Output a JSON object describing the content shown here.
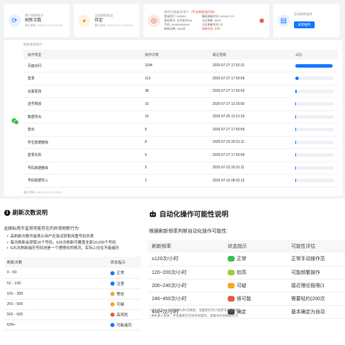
{
  "cards": {
    "c1": {
      "title": "用户刷新统计",
      "value": "刷新次数",
      "sub": "最近更新: 2025-07-27 17:52:31",
      "icon": "refresh-icon",
      "color": "#1677ff"
    },
    "c2": {
      "title": "当前刷新状态",
      "value": "待定",
      "sub": "最近更新: 2025-07-27 17:52:31",
      "icon": "user-icon",
      "color": "#f5a623"
    },
    "c3": {
      "title": "刷新次数最多用户",
      "title_tag": "（平台刷新排行榜）",
      "rows": [
        [
          "登录用户: 000001",
          "最高刷新时间: 2025-07-21"
        ],
        [
          "绑定账号: 学生账号001",
          "当日刷新: 3603"
        ],
        [
          "手机: 100000000001",
          "当日刷新时间: 次"
        ],
        [
          "刷新次数: 1184次",
          "刷新状态: 异常"
        ]
      ],
      "icon": "target-icon",
      "color": "#e4593f"
    },
    "c4": {
      "title": "自动刷新插件",
      "button": "安装插件",
      "sub": "最近更新: 2025-07-27 17:52:31",
      "icon": "document-icon",
      "color": "#1677ff"
    }
  },
  "stats_panel": {
    "title": "刷新请求统计",
    "footer": "最近更新: 2025-07-27 17:52:31",
    "headers": [
      "操作类型",
      "操作次数",
      "最近更新",
      "占比"
    ],
    "rows": [
      {
        "type": "页面访问",
        "count": "1184",
        "time": "2025-07-27 17:52:31",
        "share": 0.96
      },
      {
        "type": "登录",
        "count": "113",
        "time": "2025-07-27 17:50:59",
        "share": 0.09
      },
      {
        "type": "设置更改",
        "count": "38",
        "time": "2025-07-27 17:50:59",
        "share": 0.03
      },
      {
        "type": "选号释放",
        "count": "15",
        "time": "2025-07-27 12:25:50",
        "share": 0.012
      },
      {
        "type": "数据导出",
        "count": "10",
        "time": "2025-07-25 12:21:23",
        "share": 0.008
      },
      {
        "type": "登出",
        "count": "8",
        "time": "2025-07-27 17:50:59",
        "share": 0.006
      },
      {
        "type": "学生数据删除",
        "count": "8",
        "time": "2025-07-23 20:31:11",
        "share": 0.006
      },
      {
        "type": "登录失败",
        "count": "6",
        "time": "2025-07-27 17:50:59",
        "share": 0.005
      },
      {
        "type": "号码数据删除",
        "count": "5",
        "time": "2025-07-23 20:31:11",
        "share": 0.004
      },
      {
        "type": "号码数据导入",
        "count": "2",
        "time": "2025-07-23 08:32:12",
        "share": 0.002
      }
    ]
  },
  "left_section": {
    "title": "刷新次数说明",
    "desc": "此图标用于监测可能存在的异常刷新行为:",
    "bullets": [
      "高刷新次数可能表示用户在尝试获取闲置号码列表",
      "每次刷新会获取16个号码，625次刷新可覆盖全部10,000个号码",
      "625次刷新遍历号码池是一个理想化的情况，实际上往往不能遍历"
    ],
    "headers": [
      "刷新次数",
      "状态指示"
    ],
    "rows": [
      {
        "range": "0 - 50",
        "status": "正常",
        "color": "#1677ff"
      },
      {
        "range": "51 - 100",
        "status": "注意",
        "color": "#1677ff"
      },
      {
        "range": "101 - 200",
        "status": "警告",
        "color": "#f5a623"
      },
      {
        "range": "201 - 500",
        "status": "可疑",
        "color": "#f5a623"
      },
      {
        "range": "501 - 625",
        "status": "高风险",
        "color": "#e4593f"
      },
      {
        "range": "626+",
        "status": "可能遍历",
        "color": "#1677ff"
      }
    ]
  },
  "right_section": {
    "title": "自动化操作可能性说明",
    "desc": "根据刷新频率判断自动化操作可能性:",
    "headers": [
      "刷新频率",
      "状态指示",
      "可能性评估"
    ],
    "rows": [
      {
        "freq": "≤120次/小时",
        "status": "正常",
        "eval": "正常手动操作范",
        "color": "#3cbf4a"
      },
      {
        "freq": "120~200次/小时",
        "status": "较高",
        "eval": "可能频繁操作",
        "color": "#9ccc3c"
      },
      {
        "freq": "200~240次/小时",
        "status": "可疑",
        "eval": "接近理论极限(1",
        "color": "#f5a623"
      },
      {
        "freq": "240~450次/小时",
        "status": "很可能",
        "eval": "需要轻约(200次",
        "color": "#e4593f"
      },
      {
        "freq": "450+次/小时",
        "status": "确定",
        "eval": "基本确定为自动",
        "color": "#444444"
      }
    ],
    "notes": [
      "* 理论极限: 小程序刷新1秒/次刷新，但最新打开小程序可再次限制",
      "* 真机真人测试：手动重新打开并开始操作，观察号码的刷新时次"
    ]
  }
}
